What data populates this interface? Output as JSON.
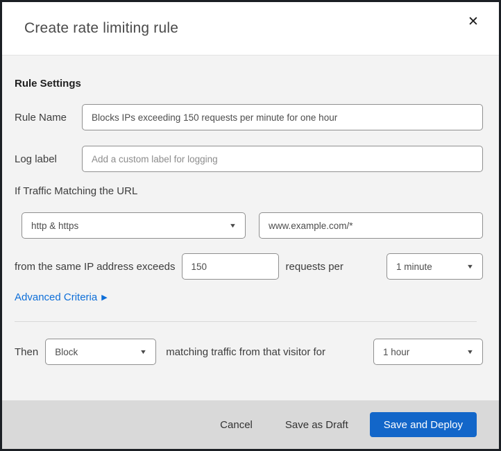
{
  "dialog": {
    "title": "Create rate limiting rule"
  },
  "icons": {
    "close": "✕",
    "chevron_down": "▼",
    "triangle_right": "▶"
  },
  "colors": {
    "primary_button_blue": "#1266c9",
    "link_blue": "#0d6ed8",
    "body_background": "#f3f3f3",
    "footer_background": "#d9d9d9",
    "dialog_border": "#1b1f24"
  },
  "form": {
    "section_heading": "Rule Settings",
    "rule_name": {
      "label": "Rule Name",
      "value": "Blocks IPs exceeding 150 requests per minute for one hour"
    },
    "log_label": {
      "label": "Log label",
      "placeholder": "Add a custom label for logging"
    },
    "traffic_match": {
      "label": "If Traffic Matching the URL",
      "scheme_selected": "http & https",
      "url_value": "www.example.com/*"
    },
    "threshold": {
      "prefix": "from the same IP address exceeds",
      "requests_value": "150",
      "middle": "requests per",
      "period_selected": "1 minute"
    },
    "advanced_criteria_label": "Advanced Criteria",
    "action": {
      "prefix": "Then",
      "action_selected": "Block",
      "middle": "matching traffic from that visitor for",
      "duration_selected": "1 hour"
    }
  },
  "footer": {
    "cancel_label": "Cancel",
    "save_draft_label": "Save as Draft",
    "save_deploy_label": "Save and Deploy"
  }
}
